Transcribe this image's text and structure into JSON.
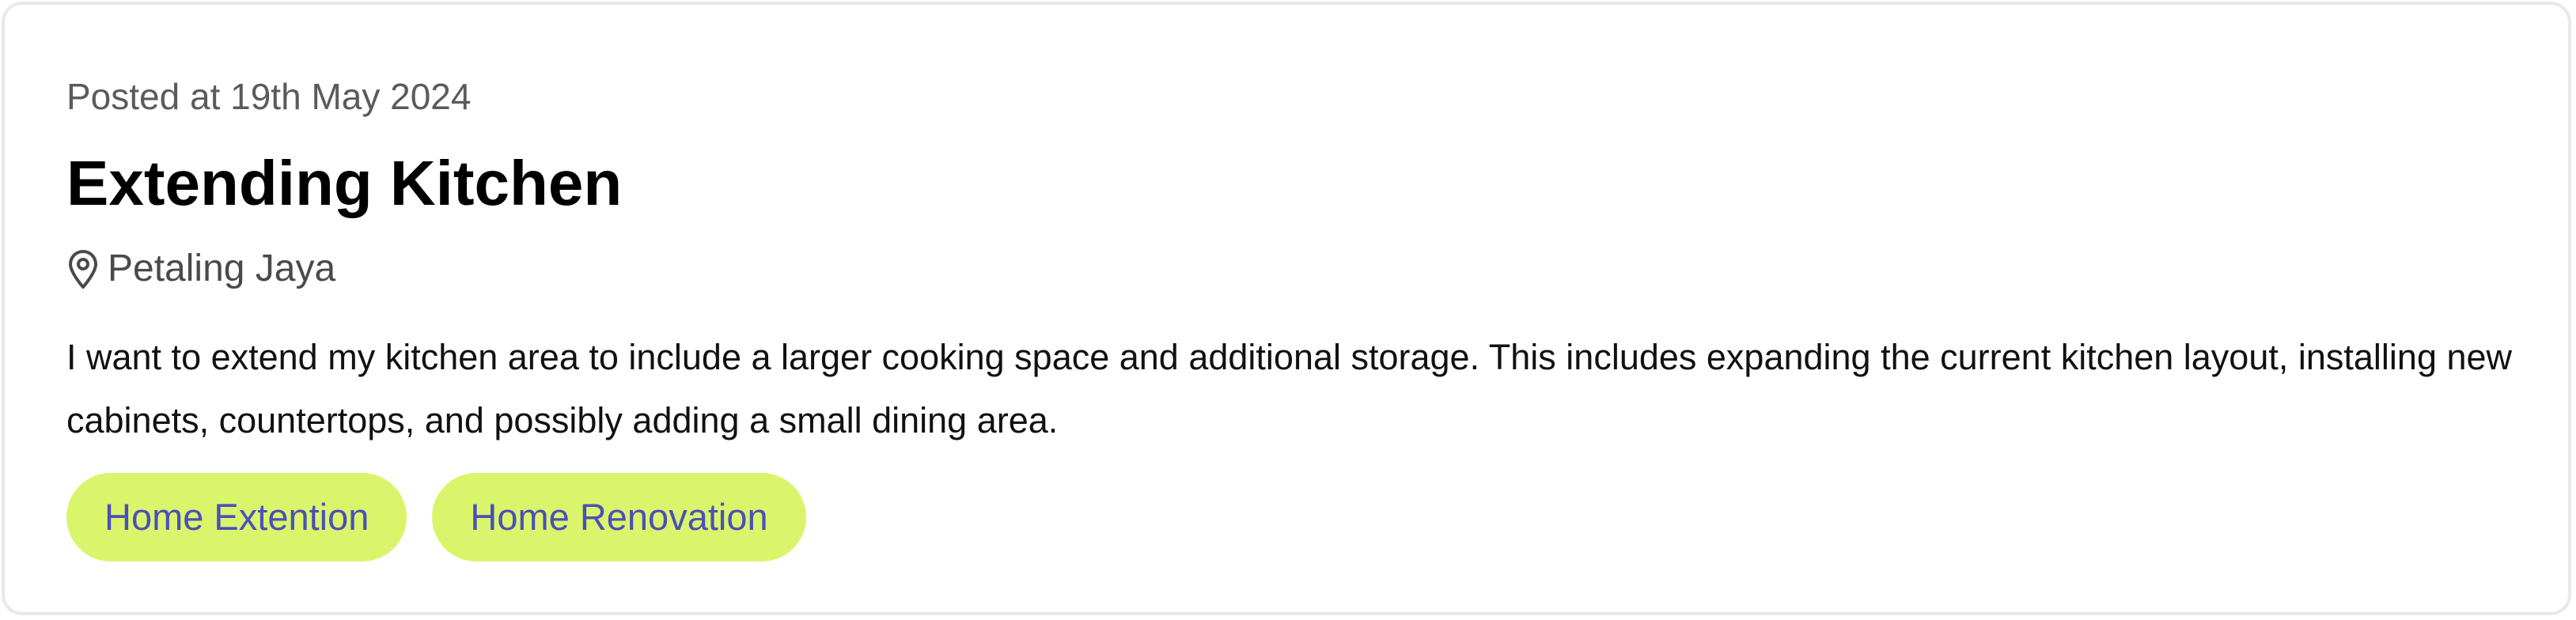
{
  "post": {
    "posted_at": "Posted at 19th May 2024",
    "title": "Extending Kitchen",
    "location": "Petaling Jaya",
    "location_icon": "map-pin-icon",
    "description": "I want to extend my kitchen area to include a larger cooking space and additional storage. This includes expanding the current kitchen layout, installing new cabinets, countertops, and possibly adding a small dining area.",
    "tags": [
      {
        "label": "Home Extention"
      },
      {
        "label": "Home Renovation"
      }
    ]
  },
  "colors": {
    "tag_background": "#daf56b",
    "tag_text": "#4b4fb8",
    "muted_text": "#5b5b5b",
    "border": "#e9e9e9"
  }
}
